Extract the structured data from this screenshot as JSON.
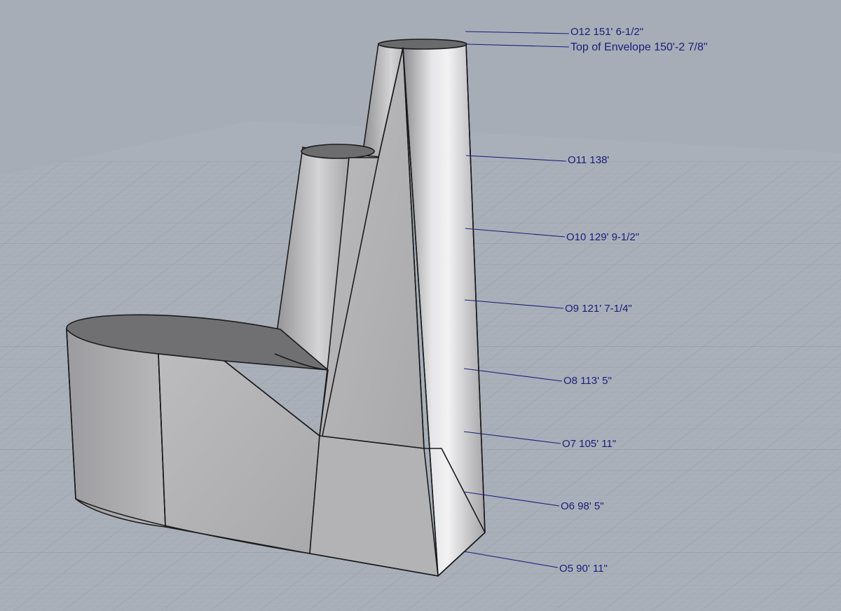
{
  "viewport": {
    "background": "#a6adb6",
    "grid_color": "#8e959f",
    "model_color": "#b9b9bb",
    "annotation_color": "#1a1e7a"
  },
  "level_labels": [
    {
      "id": "o12",
      "text": "O12 151' 6-1/2\""
    },
    {
      "id": "envelope",
      "text": "Top of Envelope 150'-2 7/8\""
    },
    {
      "id": "o11",
      "text": "O11 138'"
    },
    {
      "id": "o10",
      "text": "O10 129' 9-1/2\""
    },
    {
      "id": "o9",
      "text": "O9 121' 7-1/4\""
    },
    {
      "id": "o8",
      "text": "O8 113' 5\""
    },
    {
      "id": "o7",
      "text": "O7 105' 11\""
    },
    {
      "id": "o6",
      "text": "O6 98' 5\""
    },
    {
      "id": "o5",
      "text": "O5 90' 11\""
    }
  ]
}
